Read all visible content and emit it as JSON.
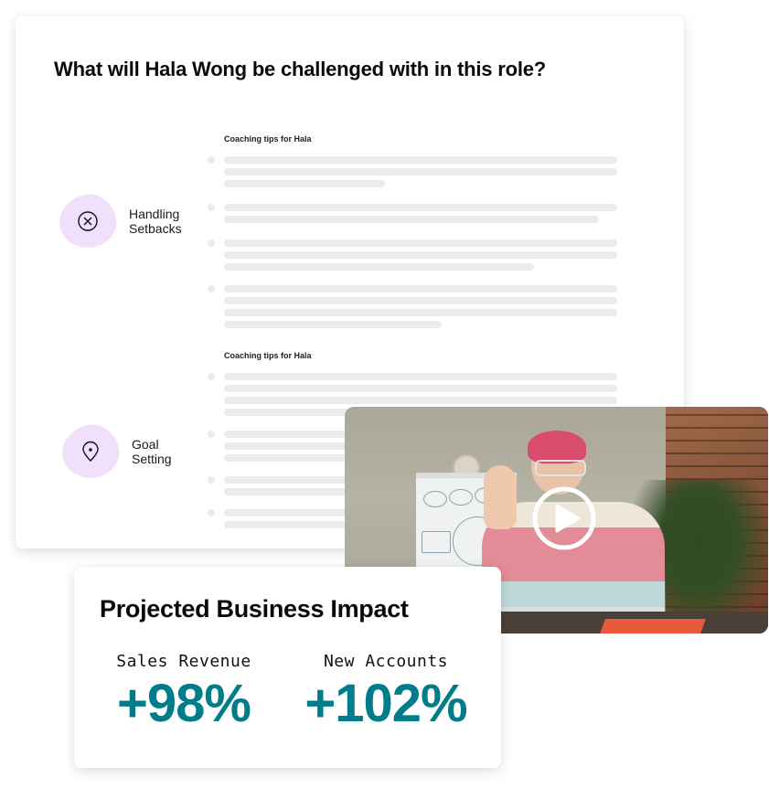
{
  "main_card": {
    "question": "What will Hala Wong be challenged with in this role?",
    "challenges": [
      {
        "label": "Handling Setbacks",
        "icon": "x-circle-icon"
      },
      {
        "label": "Goal Setting",
        "icon": "map-pin-icon"
      }
    ],
    "tip_sections": [
      {
        "heading": "Coaching tips for Hala"
      },
      {
        "heading": "Coaching tips for Hala"
      }
    ]
  },
  "video": {
    "icon": "play-icon"
  },
  "impact": {
    "title": "Projected Business Impact",
    "metrics": [
      {
        "label": "Sales Revenue",
        "value": "+98%"
      },
      {
        "label": "New Accounts",
        "value": "+102%"
      }
    ]
  },
  "colors": {
    "accent_teal": "#007d8a",
    "blob_lavender": "#f1e0fb",
    "skeleton_gray": "#ebebeb"
  }
}
